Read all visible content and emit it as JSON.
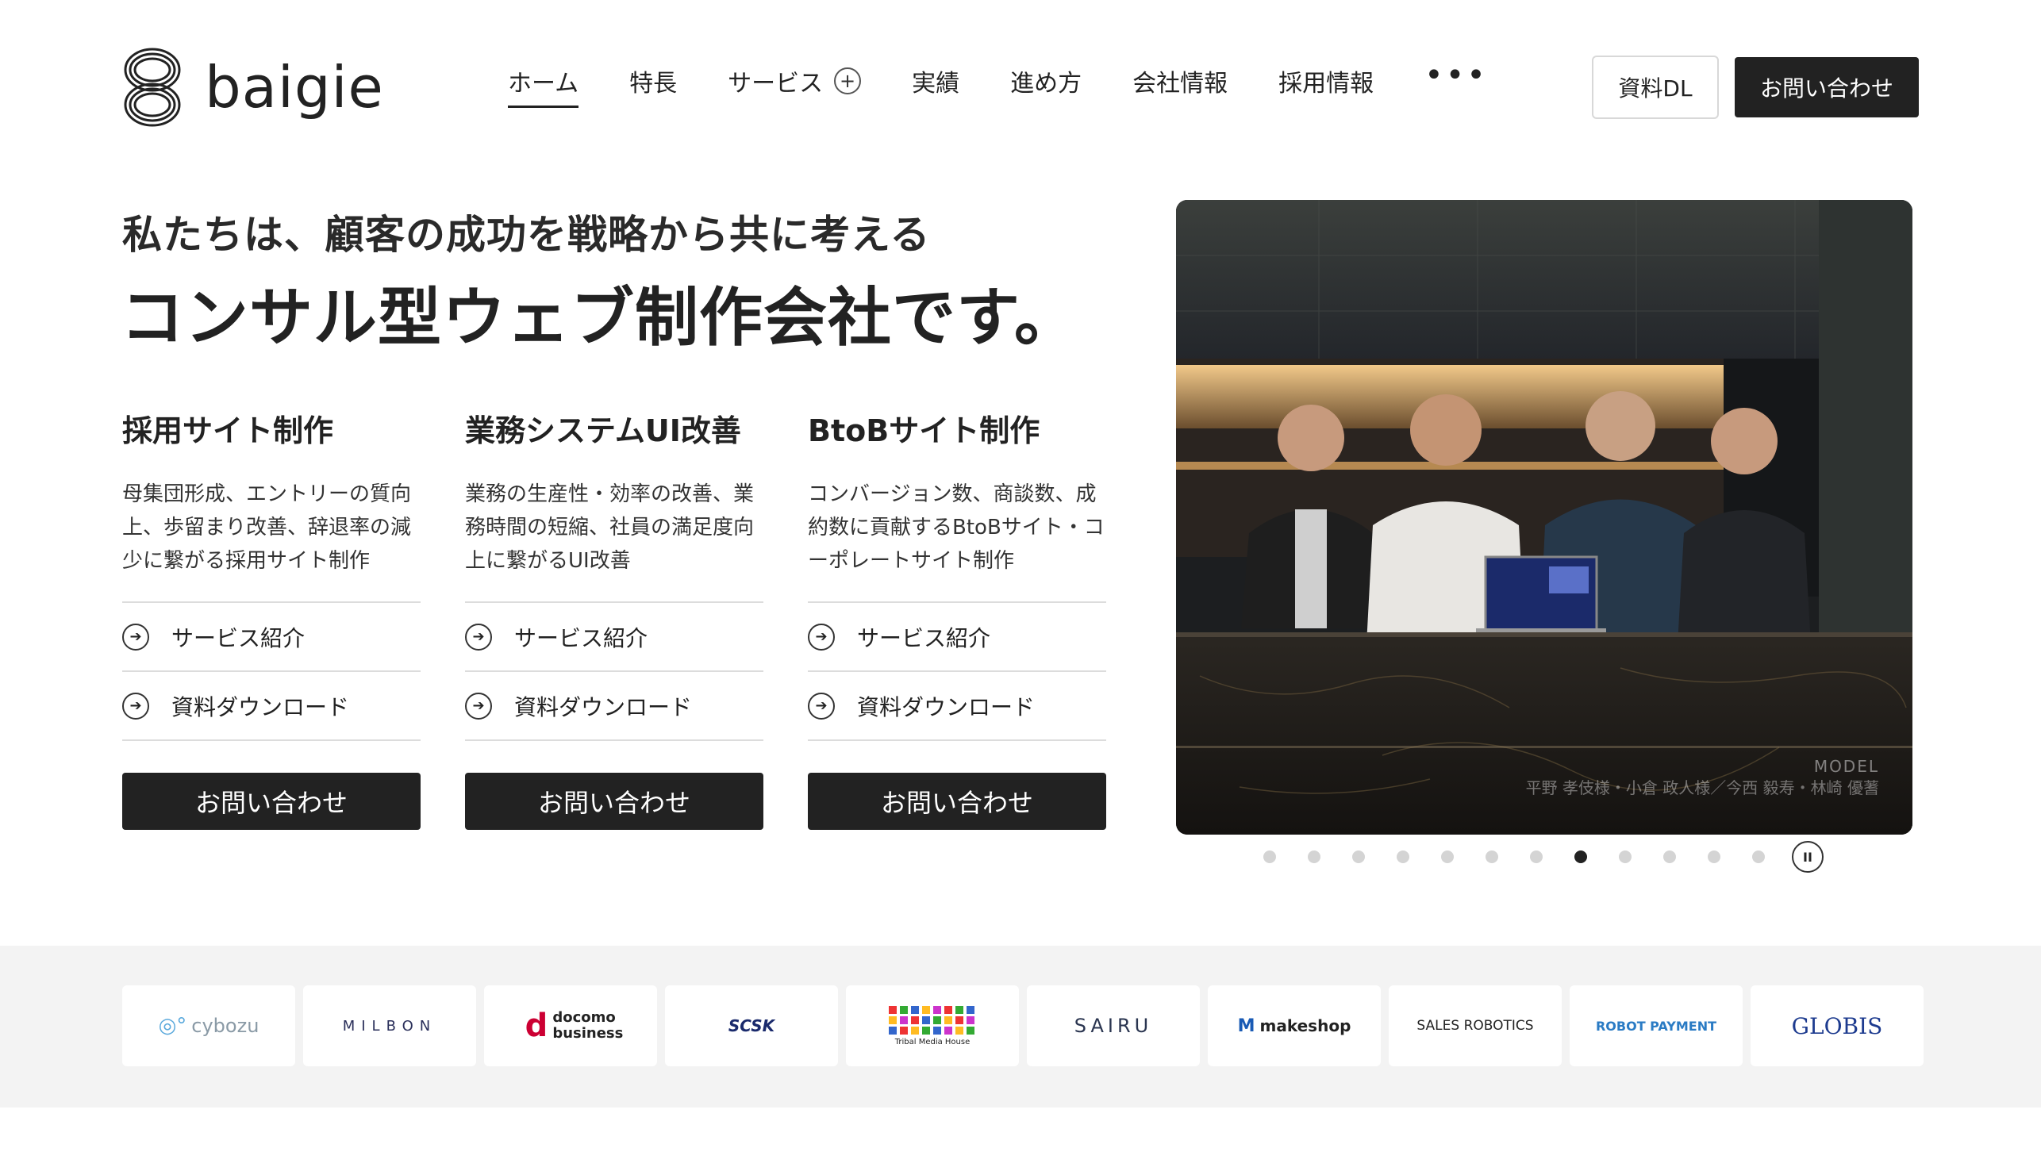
{
  "header": {
    "logo_text": "baigie",
    "nav": [
      {
        "label": "ホーム",
        "active": true
      },
      {
        "label": "特長"
      },
      {
        "label": "サービス",
        "expandable": true,
        "icon": "plus-icon"
      },
      {
        "label": "実績"
      },
      {
        "label": "進め方"
      },
      {
        "label": "会社情報"
      },
      {
        "label": "採用情報"
      }
    ],
    "more_icon": "more-icon",
    "download_label": "資料DL",
    "contact_label": "お問い合わせ"
  },
  "hero": {
    "subtitle": "私たちは、顧客の成功を戦略から共に考える",
    "title": "コンサル型ウェブ制作会社です。"
  },
  "services": [
    {
      "title": "採用サイト制作",
      "desc": "母集団形成、エントリーの質向上、歩留まり改善、辞退率の減少に繋がる採用サイト制作",
      "link1": "サービス紹介",
      "link2": "資料ダウンロード",
      "cta": "お問い合わせ"
    },
    {
      "title": "業務システムUI改善",
      "desc": "業務の生産性・効率の改善、業務時間の短縮、社員の満足度向上に繋がるUI改善",
      "link1": "サービス紹介",
      "link2": "資料ダウンロード",
      "cta": "お問い合わせ"
    },
    {
      "title": "BtoBサイト制作",
      "desc": "コンバージョン数、商談数、成約数に貢献するBtoBサイト・コーポレートサイト制作",
      "link1": "サービス紹介",
      "link2": "資料ダウンロード",
      "cta": "お問い合わせ"
    }
  ],
  "slideshow": {
    "caption_label": "MODEL",
    "caption_names": "平野 孝伎様・小倉 政人様／今西 毅寿・林崎 優蓍",
    "dot_count": 12,
    "active_dot": 8,
    "pause_icon": "pause-icon"
  },
  "clients": [
    "cybozu",
    "MILBON",
    "docomo business",
    "SCSK",
    "Tribal Media House",
    "SAIRU",
    "makeshop",
    "SALES ROBOTICS",
    "ROBOT PAYMENT",
    "GLOBIS"
  ],
  "colors": {
    "text": "#222222",
    "accent_dark": "#222222",
    "band_bg": "#f3f3f3",
    "docomo_red": "#cc0033",
    "scsk_navy": "#1a2a6c",
    "robot_payment_blue": "#2a7bc4",
    "globis_navy": "#1d3b8f"
  }
}
